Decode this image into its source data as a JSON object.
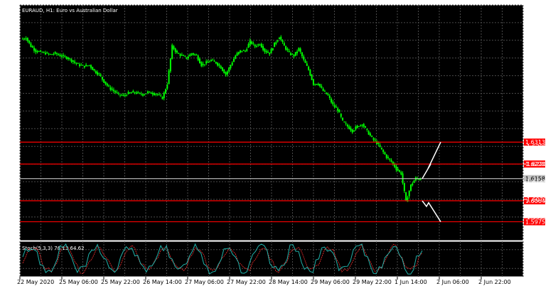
{
  "window": {
    "title": "EURAUD, H1: Euro vs Australian Dollar",
    "background": "#000000",
    "grid_color": "#4a4a4a",
    "candle_color": "#00ff00"
  },
  "chart_data": {
    "type": "candlestick",
    "symbol": "EURAUD",
    "timeframe": "H1",
    "ylim": [
      1.5895,
      1.6895
    ],
    "y_ticks": [
      "1.6895",
      "1.6820",
      "1.6745",
      "1.6670",
      "1.6595",
      "1.6520",
      "1.6445",
      "1.6370",
      "1.6295",
      "1.6220",
      "1.6145",
      "1.6070",
      "1.5995"
    ],
    "x_ticks": [
      "22 May 2020",
      "25 May 06:00",
      "25 May 22:00",
      "26 May 14:00",
      "27 May 06:00",
      "27 May 22:00",
      "28 May 14:00",
      "29 May 06:00",
      "29 May 22:00",
      "1 Jun 14:00",
      "2 Jun 06:00",
      "2 Jun 22:00"
    ],
    "price_path": [
      1.675,
      1.6755,
      1.672,
      1.67,
      1.6695,
      1.669,
      1.6685,
      1.669,
      1.668,
      1.6675,
      1.6665,
      1.665,
      1.664,
      1.6635,
      1.664,
      1.6615,
      1.66,
      1.657,
      1.6545,
      1.653,
      1.6515,
      1.651,
      1.652,
      1.6525,
      1.652,
      1.6515,
      1.6525,
      1.652,
      1.6515,
      1.65,
      1.656,
      1.672,
      1.669,
      1.668,
      1.667,
      1.669,
      1.668,
      1.664,
      1.665,
      1.666,
      1.665,
      1.663,
      1.66,
      1.664,
      1.668,
      1.67,
      1.67,
      1.674,
      1.672,
      1.673,
      1.67,
      1.669,
      1.673,
      1.676,
      1.672,
      1.669,
      1.668,
      1.671,
      1.666,
      1.662,
      1.656,
      1.656,
      1.653,
      1.651,
      1.647,
      1.645,
      1.64,
      1.638,
      1.636,
      1.638,
      1.639,
      1.636,
      1.633,
      1.631,
      1.628,
      1.625,
      1.623,
      1.62,
      1.618,
      1.606,
      1.613,
      1.616,
      1.6155
    ],
    "horizontal_lines": [
      {
        "price": 1.6313,
        "label": "1.6313",
        "color": "#ff0000"
      },
      {
        "price": 1.622,
        "label": "1.6220",
        "color": "#ff0000"
      },
      {
        "price": 1.6158,
        "label": "1.6158",
        "color": "#c0c0c0"
      },
      {
        "price": 1.6064,
        "label": "1.6064",
        "color": "#ff0000"
      },
      {
        "price": 1.5975,
        "label": "1.5975",
        "color": "#ff0000"
      }
    ],
    "projection": {
      "upper": [
        1.6158,
        1.622,
        1.62,
        1.6313
      ],
      "lower": [
        1.6064,
        1.604,
        1.5975
      ]
    }
  },
  "indicator": {
    "label": "Stoch(5,3,3) 76.13 64.62",
    "levels": [
      "100.00",
      "80.00",
      "20.00",
      "0.00"
    ],
    "main_color": "#20b2aa",
    "signal_color": "#ff3030"
  }
}
